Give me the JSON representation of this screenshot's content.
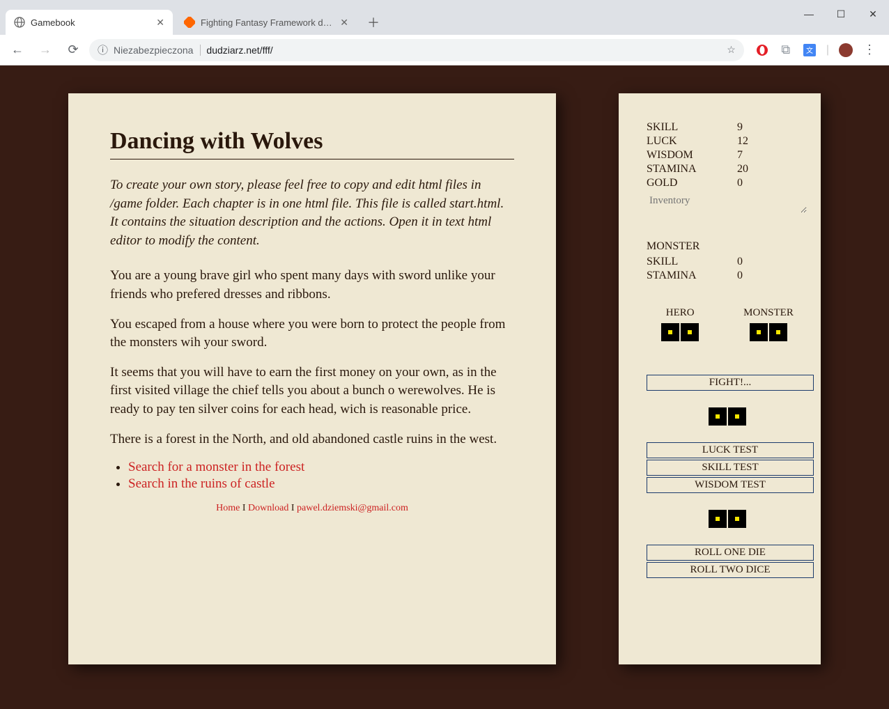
{
  "browser": {
    "tabs": [
      {
        "title": "Gamebook",
        "active": true
      },
      {
        "title": "Fighting Fantasy Framework dow…",
        "active": false
      }
    ],
    "security_label": "Niezabezpieczona",
    "url": "dudziarz.net/fff/"
  },
  "story": {
    "title": "Dancing with Wolves",
    "intro": "To create your own story, please feel free to copy and edit html files in /game folder. Each chapter is in one html file. This file is called start.html. It contains the situation description and the actions. Open it in text html editor to modify the content.",
    "paragraphs": [
      "You are a young brave girl who spent many days with sword unlike your friends who prefered dresses and ribbons.",
      "You escaped from a house where you were born to protect the people from the monsters wih your sword.",
      "It seems that you will have to earn the first money on your own, as in the first visited village the chief tells you about a bunch o werewolves. He is ready to pay ten silver coins for each head, wich is reasonable price.",
      "There is a forest in the North, and old abandoned castle ruins in the west."
    ],
    "choices": [
      "Search for a monster in the forest",
      "Search in the ruins of castle"
    ],
    "footer": {
      "home": "Home",
      "sep": " I ",
      "download": "Download",
      "email": "pawel.dziemski@gmail.com"
    }
  },
  "stats": {
    "hero": {
      "SKILL": "9",
      "LUCK": "12",
      "WISDOM": "7",
      "STAMINA": "20",
      "GOLD": "0"
    },
    "inventory_placeholder": "Inventory",
    "monster_label": "MONSTER",
    "monster": {
      "SKILL": "0",
      "STAMINA": "0"
    },
    "dice_labels": {
      "hero": "HERO",
      "monster": "MONSTER"
    },
    "buttons": {
      "fight": "FIGHT!...",
      "luck": "LUCK TEST",
      "skill": "SKILL TEST",
      "wisdom": "WISDOM TEST",
      "roll1": "ROLL ONE DIE",
      "roll2": "ROLL TWO DICE"
    }
  }
}
